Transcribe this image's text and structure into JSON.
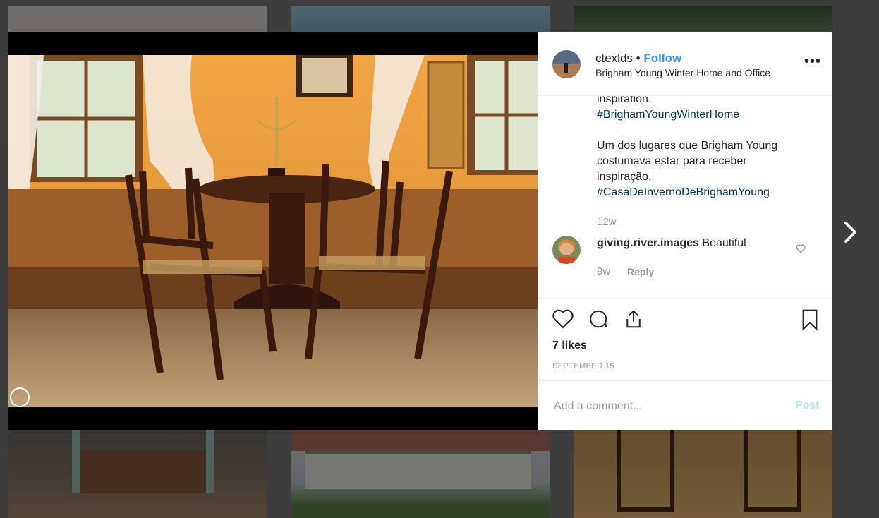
{
  "post": {
    "username": "ctexlds",
    "separator": "•",
    "follow_label": "Follow",
    "location": "Brigham Young Winter Home and Office",
    "more_icon": "more-options-icon"
  },
  "caption": {
    "line1": "inspiration.",
    "hashtag1": "#BrighamYoungWinterHome",
    "pt_line1": "Um dos lugares que Brigham Young",
    "pt_line2": "costumava estar para receber",
    "pt_line3": "inspiração.",
    "hashtag2": "#CasaDeInvernoDeBrighamYoung",
    "age": "12w"
  },
  "comment": {
    "username": "giving.river.images",
    "text": "Beautiful",
    "age": "9w",
    "reply_label": "Reply"
  },
  "actions": {
    "likes": "7 likes",
    "date": "SEPTEMBER 15"
  },
  "add_comment": {
    "placeholder": "Add a comment...",
    "post_label": "Post"
  },
  "colors": {
    "link_blue": "#3897f0",
    "hashtag": "#003569",
    "post_disabled": "#b2dffc"
  }
}
